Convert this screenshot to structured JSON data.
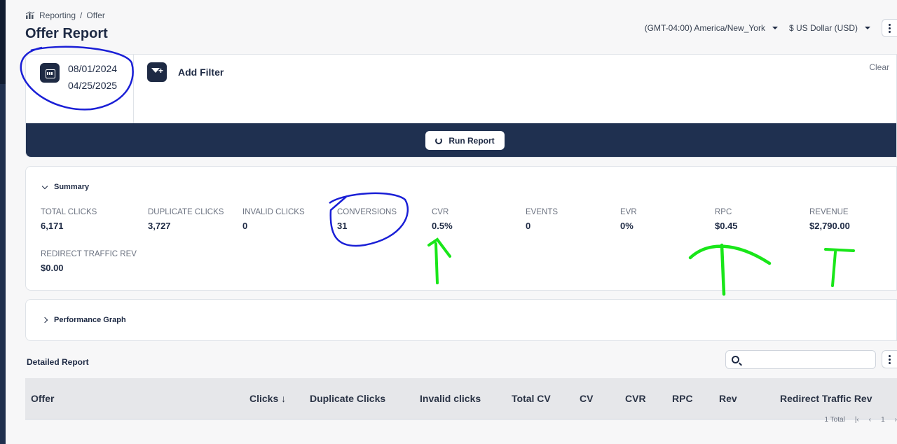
{
  "breadcrumb": {
    "section": "Reporting",
    "separator": "/",
    "current": "Offer"
  },
  "page_title": "Offer Report",
  "header": {
    "timezone": "(GMT-04:00) America/New_York",
    "currency": "$ US Dollar (USD)"
  },
  "filters": {
    "date_start": "08/01/2024",
    "date_end": "04/25/2025",
    "add_filter_label": "Add Filter",
    "clear_label": "Clear",
    "run_report_label": "Run Report"
  },
  "summary": {
    "title": "Summary",
    "metrics": [
      {
        "label": "TOTAL CLICKS",
        "value": "6,171"
      },
      {
        "label": "DUPLICATE CLICKS",
        "value": "3,727"
      },
      {
        "label": "INVALID CLICKS",
        "value": "0"
      },
      {
        "label": "CONVERSIONS",
        "value": "31"
      },
      {
        "label": "CVR",
        "value": "0.5%"
      },
      {
        "label": "EVENTS",
        "value": "0"
      },
      {
        "label": "EVR",
        "value": "0%"
      },
      {
        "label": "RPC",
        "value": "$0.45"
      },
      {
        "label": "REVENUE",
        "value": "$2,790.00"
      },
      {
        "label": "REDIRECT TRAFFIC REV",
        "value": "$0.00"
      }
    ]
  },
  "performance_graph": {
    "title": "Performance Graph"
  },
  "detailed_report": {
    "title": "Detailed Report",
    "search_value": "",
    "columns": [
      "Offer",
      "Clicks ↓",
      "Duplicate Clicks",
      "Invalid clicks",
      "Total CV",
      "CV",
      "CVR",
      "RPC",
      "Rev",
      "Redirect Traffic Rev"
    ],
    "pagination": {
      "total": "1 Total",
      "page": "1"
    }
  },
  "colors": {
    "navy": "#1f3050",
    "annotation_blue": "#1a1fd6",
    "annotation_green": "#19e619"
  }
}
